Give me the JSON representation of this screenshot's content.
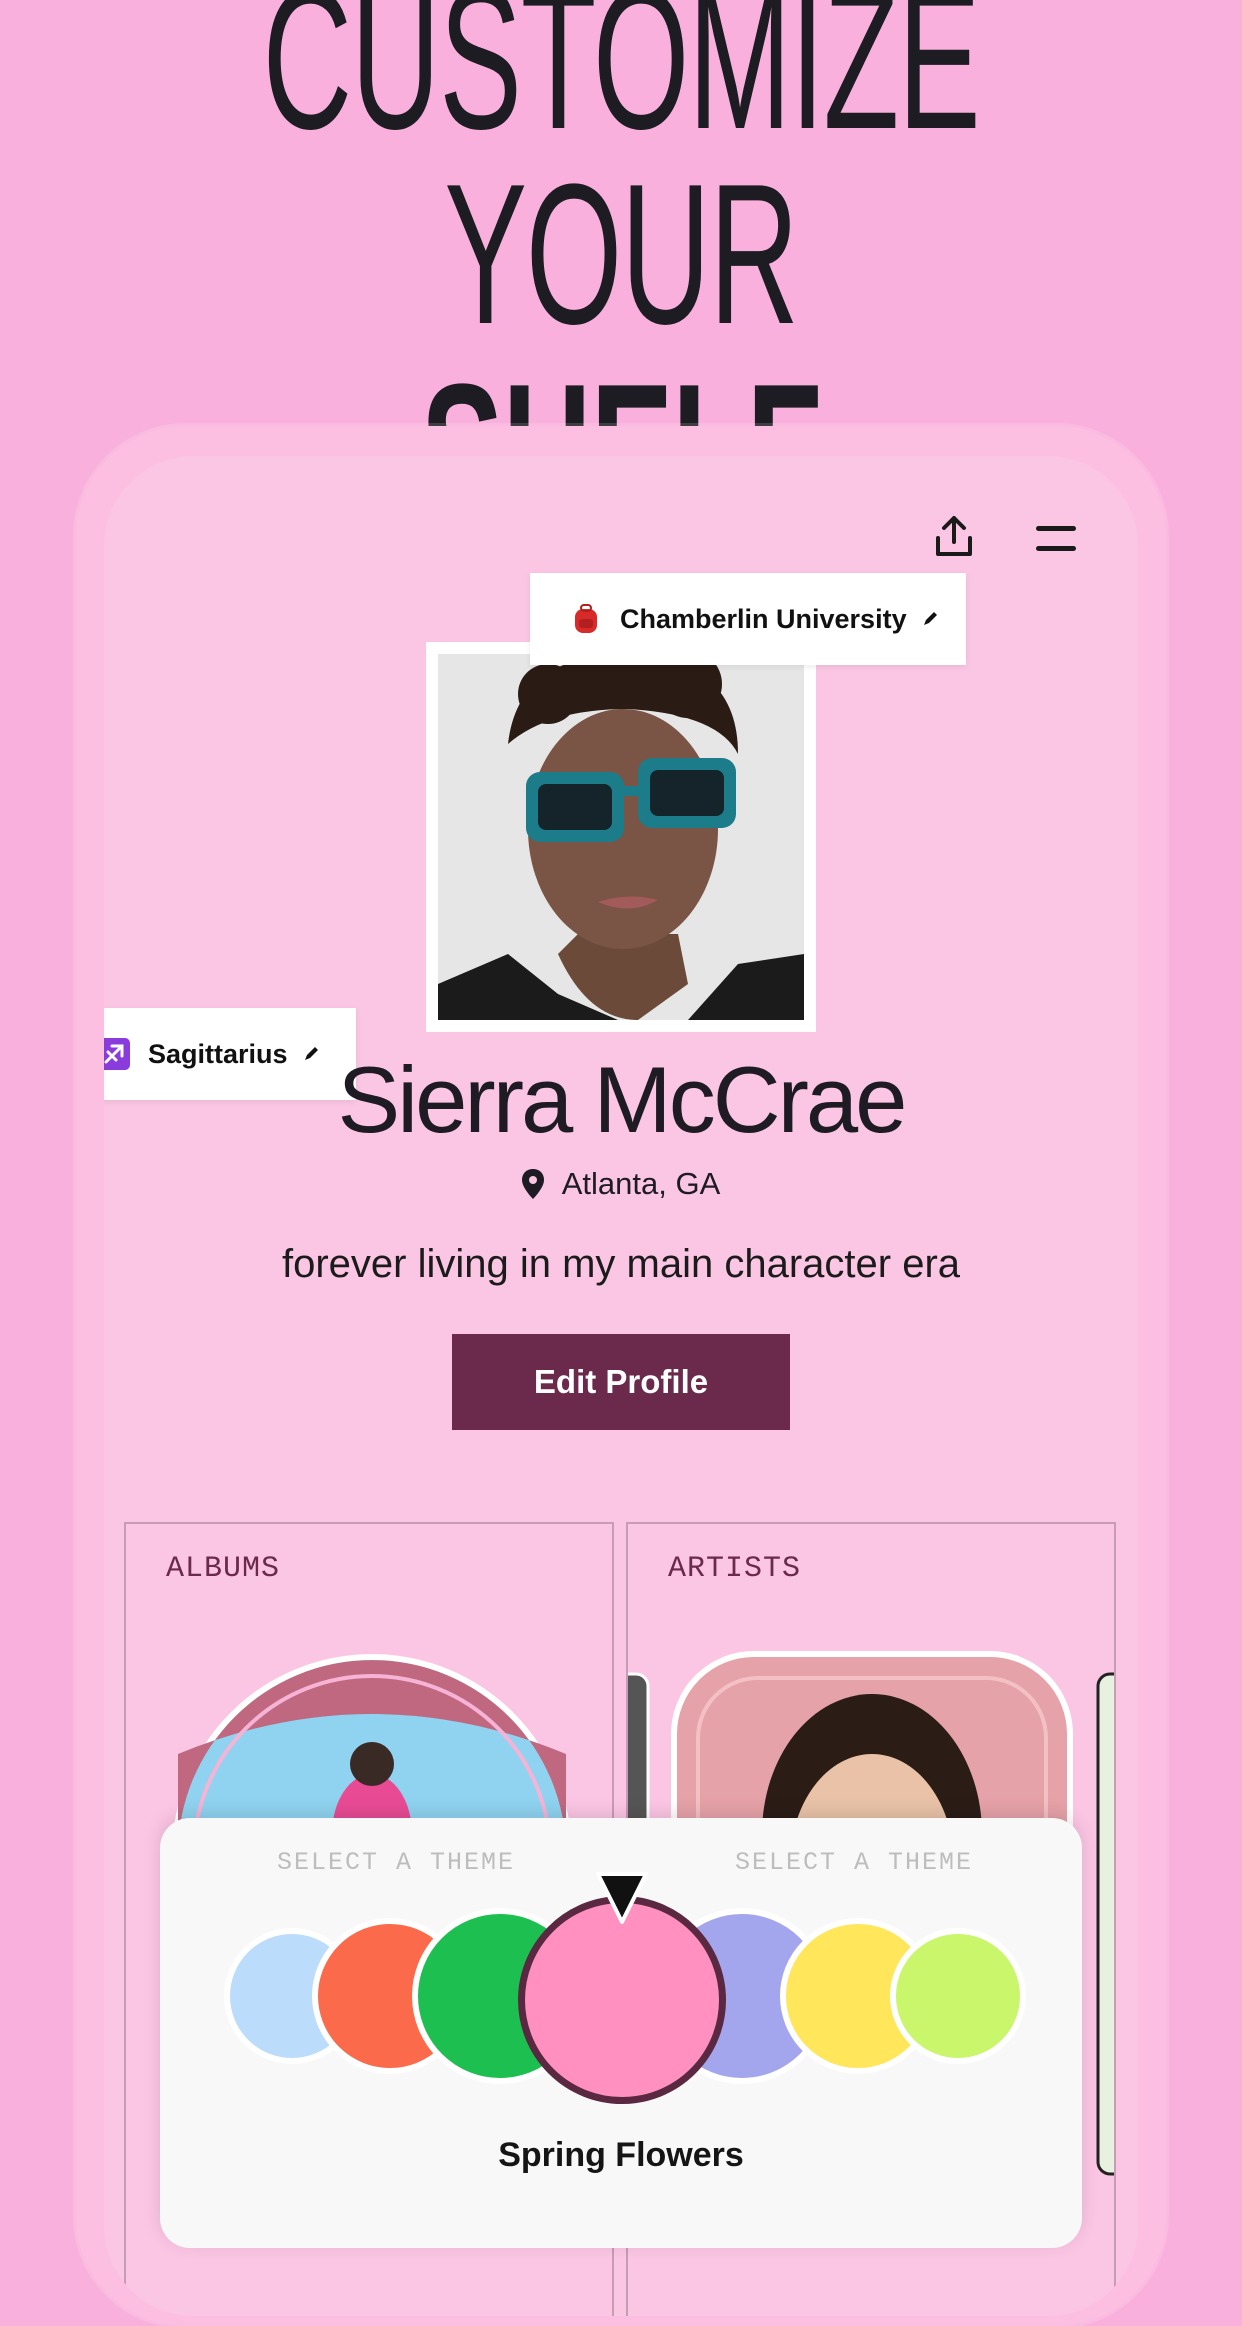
{
  "headline": {
    "line1": "CUSTOMIZE",
    "line2_light": "YOUR ",
    "line2_bold": "SHELF"
  },
  "profile": {
    "school_tag": "Chamberlin University",
    "sign_tag": "Sagittarius",
    "name": "Sierra McCrae",
    "location": "Atlanta, GA",
    "bio": "forever living in my main character era",
    "edit_button": "Edit Profile"
  },
  "cards": {
    "albums_label": "ALBUMS",
    "artists_label": "ARTISTS"
  },
  "theme_picker": {
    "label_left": "SELECT A THEME",
    "label_right": "SELECT A THEME",
    "selected_name": "Spring Flowers",
    "swatches": [
      "#bcdcfb",
      "#fb6a4a",
      "#1dbf50",
      "#ff90bf",
      "#a3a6ec",
      "#ffe65a",
      "#c9f66a"
    ],
    "selected_color": "#ff90bf"
  },
  "colors": {
    "background": "#fab0dc",
    "accent": "#6b2a4b",
    "card": "#fbc6e4"
  },
  "icons": [
    "share-icon",
    "menu-icon",
    "backpack-icon",
    "sagittarius-icon",
    "pencil-icon",
    "location-pin-icon"
  ]
}
